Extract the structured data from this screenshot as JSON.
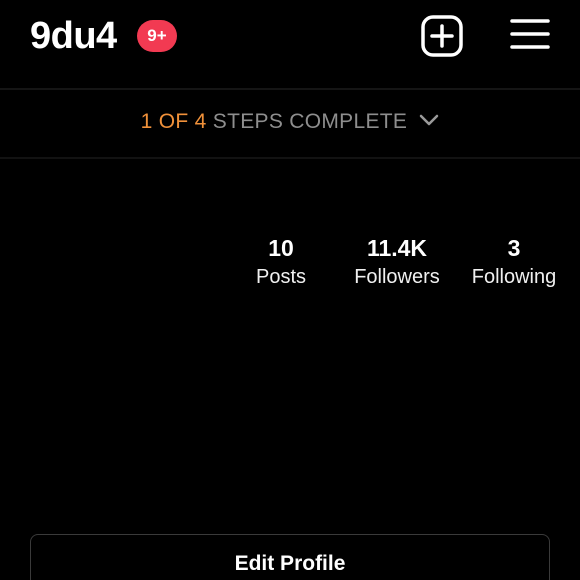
{
  "header": {
    "username": "9du4",
    "notification_badge": "9+",
    "new_post_icon": "plus-square-icon",
    "menu_icon": "hamburger-menu-icon"
  },
  "steps_banner": {
    "completed_text": "1 OF 4",
    "rest_text": "STEPS COMPLETE",
    "icon": "chevron-down-icon",
    "completed_color": "#f0913a"
  },
  "stats": {
    "posts": {
      "value": "10",
      "label": "Posts"
    },
    "followers": {
      "value": "11.4K",
      "label": "Followers"
    },
    "following": {
      "value": "3",
      "label": "Following"
    }
  },
  "actions": {
    "edit_profile_label": "Edit Profile"
  },
  "colors": {
    "background": "#000000",
    "badge": "#f23a52",
    "text": "#ffffff",
    "muted": "#8e8e8e"
  }
}
